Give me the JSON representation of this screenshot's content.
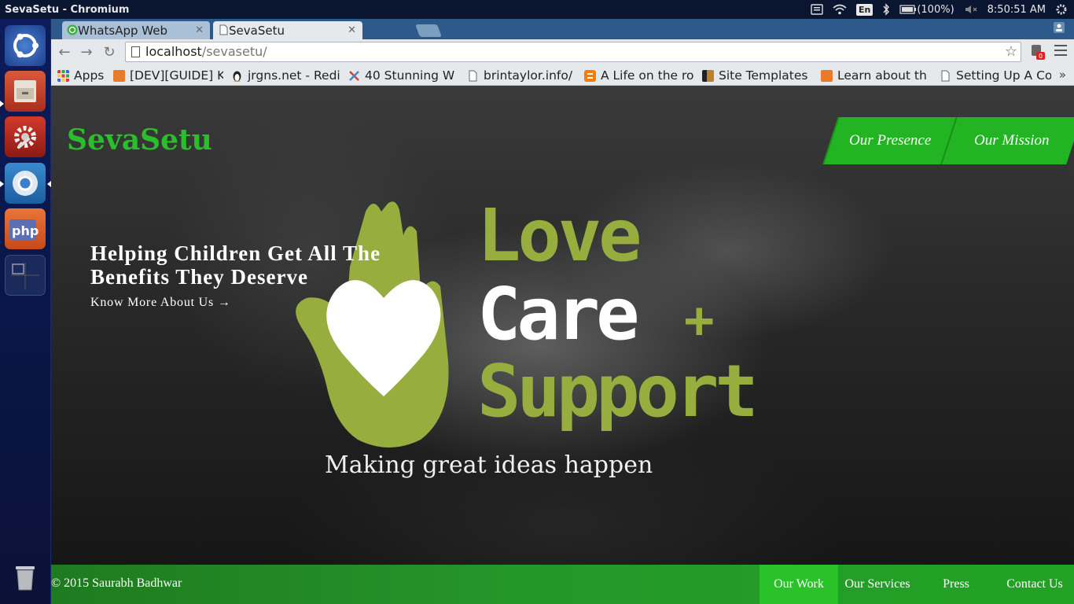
{
  "os": {
    "window_title": "SevaSetu - Chromium",
    "indicators": {
      "keyboard_lang": "En",
      "battery": "(100%)",
      "clock": "8:50:51 AM"
    }
  },
  "browser": {
    "tabs": [
      {
        "label": "WhatsApp Web",
        "icon": "whatsapp-icon",
        "active": false
      },
      {
        "label": "SevaSetu",
        "icon": "page-icon",
        "active": true
      }
    ],
    "url_host": "localhost",
    "url_path": "/sevasetu/",
    "extension_badge": "0",
    "bookmarks": [
      {
        "label": "Apps",
        "icon": "apps-grid-icon"
      },
      {
        "label": "[DEV][GUIDE] K",
        "icon": "xda-icon"
      },
      {
        "label": "jrgns.net - Redi",
        "icon": "tux-icon"
      },
      {
        "label": "40 Stunning W",
        "icon": "tools-icon"
      },
      {
        "label": "brintaylor.info/",
        "icon": "page-icon"
      },
      {
        "label": "A Life on the ro",
        "icon": "blogger-icon"
      },
      {
        "label": "Site Templates",
        "icon": "templates-icon"
      },
      {
        "label": "Learn about th",
        "icon": "xda-icon"
      },
      {
        "label": "Setting Up A Co",
        "icon": "page-icon"
      }
    ],
    "bookmarks_more": "»"
  },
  "site": {
    "brand": "SevaSetu",
    "nav": [
      "Our Presence",
      "Our Mission"
    ],
    "hero": {
      "heading": "Helping Children Get All The Benefits They Deserve",
      "link": "Know More About Us →"
    },
    "logo": {
      "line1": "Love",
      "line2": "Care",
      "plus": "+",
      "line3": "Support",
      "tagline": "Making great ideas happen"
    },
    "footer": {
      "copyright": "© 2015 Saurabh Badhwar",
      "nav": [
        "Our Work",
        "Our Services",
        "Press",
        "Contact Us"
      ],
      "active": "Our Work"
    }
  },
  "colors": {
    "brand_green": "#2bbd2b",
    "logo_green": "#97ad3d",
    "footer_green": "#25962a"
  }
}
